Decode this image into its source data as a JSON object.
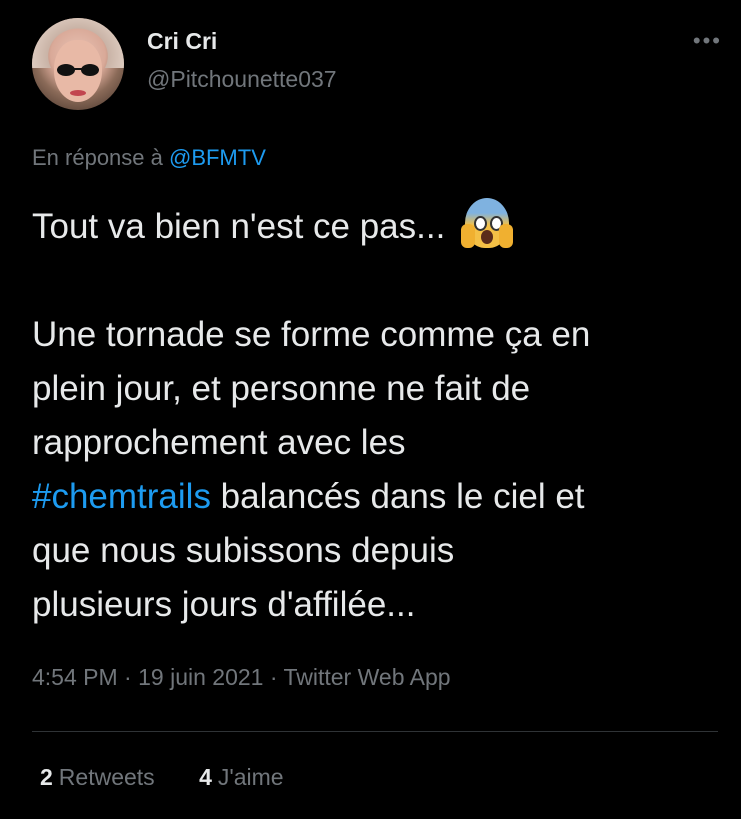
{
  "user": {
    "display_name": "Cri Cri",
    "handle": "@Pitchounette037",
    "more_label": "•••"
  },
  "reply": {
    "prefix": "En réponse à ",
    "mention": "@BFMTV"
  },
  "tweet": {
    "line1_text": "Tout va bien n'est ce pas... ",
    "emoji_icon": "face-screaming-in-fear-icon",
    "para2_lines": [
      "Une tornade se forme comme ça en",
      "plein jour, et personne ne fait de",
      "rapprochement avec les"
    ],
    "hashtag": "#chemtrails",
    "after_hashtag": " balancés dans le ciel et",
    "para2_tail": [
      "que nous subissons depuis",
      "plusieurs jours d'affilée..."
    ]
  },
  "meta": {
    "time": "4:54 PM",
    "sep1": " · ",
    "date": "19 juin 2021",
    "sep2": " · ",
    "source": "Twitter Web App"
  },
  "stats": {
    "retweets_count": "2",
    "retweets_label": "Retweets",
    "likes_count": "4",
    "likes_label": "J'aime"
  },
  "colors": {
    "background": "#000000",
    "text": "#e7e9ea",
    "muted": "#71767b",
    "accent": "#1d9bf0",
    "divider": "#2f3336"
  }
}
